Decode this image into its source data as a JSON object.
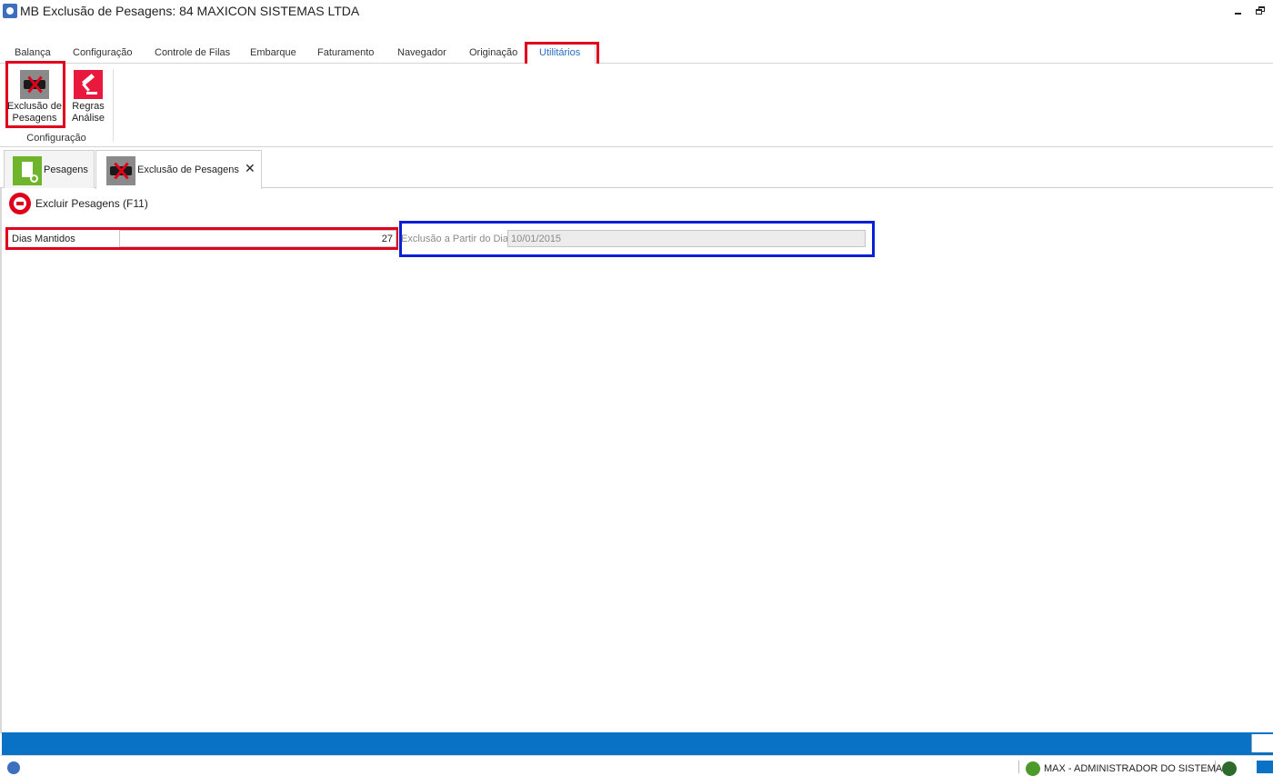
{
  "window": {
    "title": "MB Exclusão de Pesagens: 84 MAXICON SISTEMAS LTDA"
  },
  "ribbon": {
    "tabs": [
      {
        "label": "Balança"
      },
      {
        "label": "Configuração"
      },
      {
        "label": "Controle de Filas"
      },
      {
        "label": "Embarque"
      },
      {
        "label": "Faturamento"
      },
      {
        "label": "Navegador"
      },
      {
        "label": "Originação"
      },
      {
        "label": "Utilitários"
      }
    ],
    "active_tab": "Utilitários",
    "group": {
      "label": "Configuração",
      "buttons": [
        {
          "label": "Exclusão de Pesagens",
          "icon": "truck-delete-icon"
        },
        {
          "label": "Regras Análise",
          "icon": "gavel-icon"
        }
      ]
    }
  },
  "doc_tabs": [
    {
      "label": "Pesagens",
      "icon": "document-gear-icon"
    },
    {
      "label": "Exclusão de Pesagens",
      "icon": "truck-delete-icon",
      "closable": true
    }
  ],
  "toolbar": {
    "delete_label": "Excluir Pesagens (F11)"
  },
  "form": {
    "dias_mantidos": {
      "label": "Dias Mantidos",
      "value": "27"
    },
    "exclusao_a_partir": {
      "label": "Exclusão a Partir do Dia",
      "value": "10/01/2015",
      "disabled": true
    }
  },
  "status": {
    "user": "MAX - ADMINISTRADOR DO SISTEMA"
  },
  "colors": {
    "accent_blue": "#0a72c4",
    "highlight_red": "#e0001b",
    "highlight_blue": "#0b1fd6",
    "active_tab_text": "#2a6dc4"
  }
}
